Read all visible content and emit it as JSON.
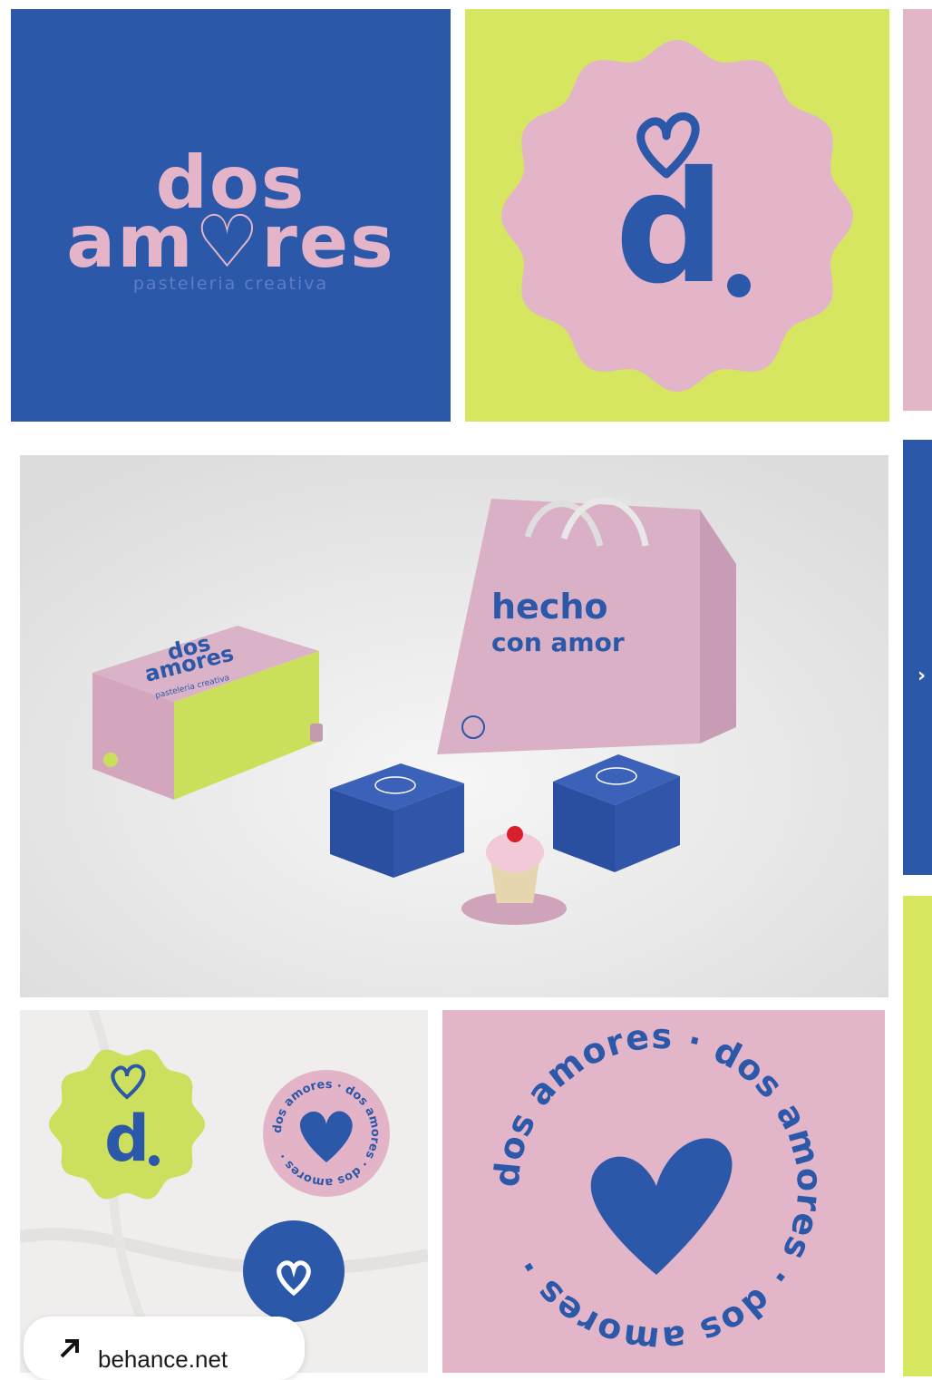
{
  "brand": {
    "line1": "dos",
    "line2": "am♡res",
    "tagline": "pasteleria creativa",
    "monogram": "d"
  },
  "bag_text": [
    "hecho",
    "con amor"
  ],
  "box_text": [
    "dos",
    "amores",
    "pasteleria creativa"
  ],
  "circle_text": "dos amores · dos amores · dos amores · ",
  "side_arrow": "›",
  "source_link": "behance.net",
  "colors": {
    "blue": "#2b58a8",
    "pink": "#e3b5c9",
    "lime": "#d6e661"
  },
  "icons": {
    "heart": "heart-icon",
    "arrow": "arrow-up-right-icon"
  }
}
